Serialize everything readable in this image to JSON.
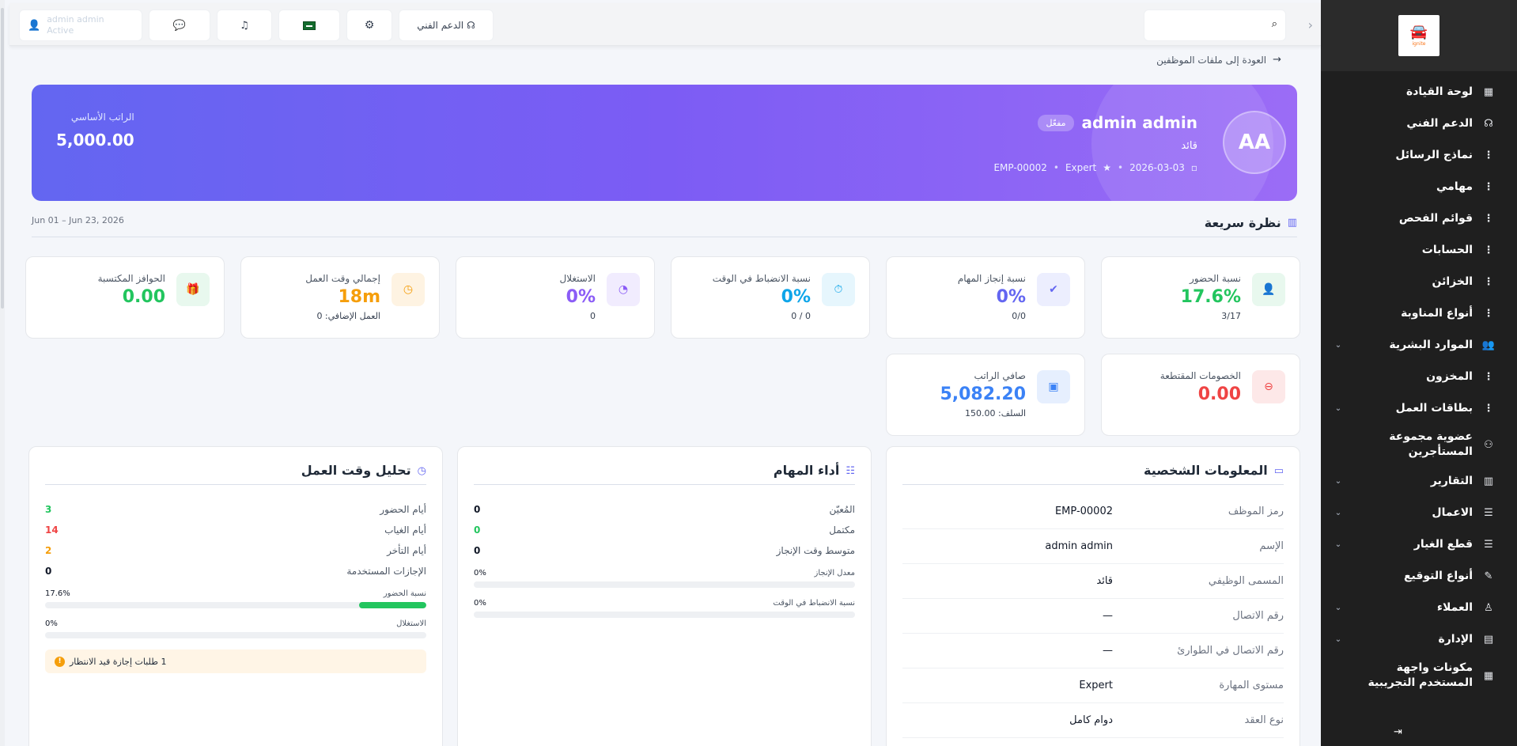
{
  "sidebar": {
    "logo_text": "ignite",
    "items": [
      {
        "label": "لوحة القيادة",
        "icon": "grid-icon",
        "glyph": "▦",
        "chevron": false
      },
      {
        "label": "الدعم الفني",
        "icon": "headset-icon",
        "glyph": "☊",
        "chevron": false
      },
      {
        "label": "نماذج الرسائل",
        "icon": "dots-icon",
        "glyph": "⋮",
        "chevron": false
      },
      {
        "label": "مهامي",
        "icon": "dots-icon",
        "glyph": "⋮",
        "chevron": false
      },
      {
        "label": "قوائم الفحص",
        "icon": "dots-icon",
        "glyph": "⋮",
        "chevron": false
      },
      {
        "label": "الحسابات",
        "icon": "dots-icon",
        "glyph": "⋮",
        "chevron": false
      },
      {
        "label": "الخزائن",
        "icon": "dots-icon",
        "glyph": "⋮",
        "chevron": false
      },
      {
        "label": "أنواع المناوبة",
        "icon": "dots-icon",
        "glyph": "⋮",
        "chevron": false
      },
      {
        "label": "الموارد البشرية",
        "icon": "users-icon",
        "glyph": "👥",
        "chevron": true
      },
      {
        "label": "المخزون",
        "icon": "dots-icon",
        "glyph": "⋮",
        "chevron": false
      },
      {
        "label": "بطاقات العمل",
        "icon": "dots-icon",
        "glyph": "⋮",
        "chevron": true
      },
      {
        "label": "عضوية مجموعة المستأجرين",
        "icon": "group-icon",
        "glyph": "⚇",
        "chevron": false
      },
      {
        "label": "التقارير",
        "icon": "chart-icon",
        "glyph": "▥",
        "chevron": true
      },
      {
        "label": "الاعمال",
        "icon": "sliders-icon",
        "glyph": "☰",
        "chevron": true
      },
      {
        "label": "قطع الغيار",
        "icon": "sliders-icon",
        "glyph": "☰",
        "chevron": true
      },
      {
        "label": "أنواع التوقيع",
        "icon": "pen-icon",
        "glyph": "✎",
        "chevron": false
      },
      {
        "label": "العملاء",
        "icon": "user-tie-icon",
        "glyph": "♙",
        "chevron": true
      },
      {
        "label": "الإدارة",
        "icon": "building-icon",
        "glyph": "▤",
        "chevron": true
      },
      {
        "label": "مكونات واجهة المستخدم التجريبية",
        "icon": "components-icon",
        "glyph": "▦",
        "chevron": false
      }
    ]
  },
  "topbar": {
    "search_placeholder": "",
    "support_label": "الدعم الفني",
    "user_name": "admin admin",
    "user_status": "Active"
  },
  "breadcrumb": {
    "back_label": "العودة إلى ملفات الموظفين"
  },
  "hero": {
    "initials": "AA",
    "name": "admin admin",
    "badge": "مفعّل",
    "role": "قائد",
    "date": "2026-03-03",
    "skill": "Expert",
    "code": "EMP-00002",
    "salary_label": "الراتب الأساسي",
    "salary_value": "5,000.00"
  },
  "quick_view": {
    "title": "نظرة سريعة",
    "date_range": "Jun 01 – Jun 23, 2026"
  },
  "stats": [
    {
      "label": "نسبة الحضور",
      "value": "17.6%",
      "sub": "3/17",
      "color": "#22c55e",
      "bg": "#e8f8ee",
      "icon": "user-check-icon",
      "glyph": "👤"
    },
    {
      "label": "نسبة إنجاز المهام",
      "value": "0%",
      "sub": "0/0",
      "color": "#6366f1",
      "bg": "#eceefe",
      "icon": "check-circle-icon",
      "glyph": "✔"
    },
    {
      "label": "نسبة الانضباط في الوقت",
      "value": "0%",
      "sub": "0 / 0",
      "color": "#0ea5e9",
      "bg": "#e6f6fd",
      "icon": "stopwatch-icon",
      "glyph": "⏱"
    },
    {
      "label": "الاستغلال",
      "value": "0%",
      "sub": "0",
      "color": "#8b5cf6",
      "bg": "#f1ecfe",
      "icon": "pie-icon",
      "glyph": "◔"
    },
    {
      "label": "إجمالي وقت العمل",
      "value": "18m",
      "sub": "العمل الإضافي: 0",
      "color": "#f59e0b",
      "bg": "#fef3e2",
      "icon": "clock-icon",
      "glyph": "◷"
    },
    {
      "label": "الحوافز المكتسبة",
      "value": "0.00",
      "sub": "",
      "color": "#22c55e",
      "bg": "#e8f8ee",
      "icon": "gift-icon",
      "glyph": "🎁"
    },
    {
      "label": "الخصومات المقتطعة",
      "value": "0.00",
      "sub": "",
      "color": "#ef4444",
      "bg": "#fde8e8",
      "icon": "minus-circle-icon",
      "glyph": "⊖"
    },
    {
      "label": "صافي الراتب",
      "value": "5,082.20",
      "sub": "السلف: 150.00",
      "color": "#3b82f6",
      "bg": "#e6effe",
      "icon": "money-icon",
      "glyph": "▣"
    }
  ],
  "personal": {
    "title": "المعلومات الشخصية",
    "rows": [
      {
        "key": "رمز الموظف",
        "value": "EMP-00002"
      },
      {
        "key": "الإسم",
        "value": "admin admin"
      },
      {
        "key": "المسمى الوظيفي",
        "value": "قائد"
      },
      {
        "key": "رقم الاتصال",
        "value": "—"
      },
      {
        "key": "رقم الاتصال في الطوارئ",
        "value": "—"
      },
      {
        "key": "مستوى المهارة",
        "value": "Expert"
      },
      {
        "key": "نوع العقد",
        "value": "دوام كامل"
      }
    ]
  },
  "tasks": {
    "title": "أداء المهام",
    "rows": [
      {
        "key": "المُعيّن",
        "value": "0",
        "color": "#111827"
      },
      {
        "key": "مكتمل",
        "value": "0",
        "color": "#22c55e"
      },
      {
        "key": "متوسط وقت الإنجاز",
        "value": "0",
        "color": "#111827"
      }
    ],
    "bars": [
      {
        "label": "معدل الإنجاز",
        "percent_text": "0%",
        "percent": 0,
        "color": "#6366f1"
      },
      {
        "label": "نسبة الانضباط في الوقت",
        "percent_text": "0%",
        "percent": 0,
        "color": "#0ea5e9"
      }
    ]
  },
  "worktime": {
    "title": "تحليل وقت العمل",
    "rows": [
      {
        "key": "أيام الحضور",
        "value": "3",
        "color": "#22c55e"
      },
      {
        "key": "أيام الغياب",
        "value": "14",
        "color": "#ef4444"
      },
      {
        "key": "أيام التأخر",
        "value": "2",
        "color": "#f59e0b"
      },
      {
        "key": "الإجازات المستخدمة",
        "value": "0",
        "color": "#111827"
      }
    ],
    "bars": [
      {
        "label": "نسبة الحضور",
        "percent_text": "17.6%",
        "percent": 17.6,
        "color": "#22c55e"
      },
      {
        "label": "الاستغلال",
        "percent_text": "0%",
        "percent": 0,
        "color": "#8b5cf6"
      }
    ],
    "leave_note": "1 طلبات إجازة قيد الانتظار"
  },
  "logout_icon": "logout-icon"
}
